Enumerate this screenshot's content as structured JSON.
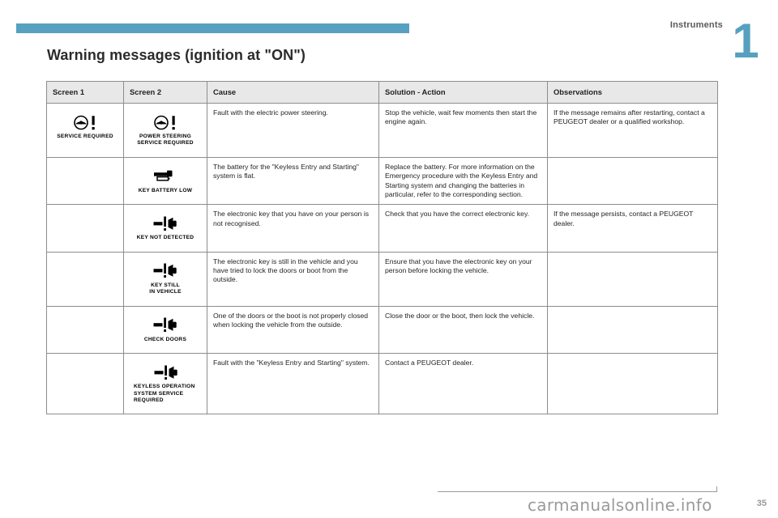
{
  "header": {
    "chapter_name": "Instruments",
    "chapter_number": "1"
  },
  "section_title": "Warning messages (ignition at \"ON\")",
  "table": {
    "columns": [
      "Screen 1",
      "Screen 2",
      "Cause",
      "Solution - Action",
      "Observations"
    ],
    "rows": [
      {
        "screen1": {
          "icon": "steering-wheel-warning-icon",
          "label": "SERVICE REQUIRED",
          "label_align": "center"
        },
        "screen2": {
          "icon": "steering-wheel-warning-icon",
          "label": "POWER STEERING\nSERVICE REQUIRED",
          "label_align": "center"
        },
        "cause": "Fault with the electric power steering.",
        "solution": "Stop the vehicle, wait few moments then start the engine again.",
        "observations": "If the message remains after restarting, contact a PEUGEOT dealer or a qualified workshop."
      },
      {
        "screen1": null,
        "screen2": {
          "icon": "key-battery-icon",
          "label": "KEY BATTERY LOW",
          "label_align": "center"
        },
        "cause": "The battery for the \"Keyless Entry and Starting\" system is flat.",
        "solution": "Replace the battery. For more information on the Emergency procedure with the Keyless Entry and Starting system and changing the batteries in particular, refer to the corresponding section.",
        "observations": ""
      },
      {
        "screen1": null,
        "screen2": {
          "icon": "key-not-detected-icon",
          "label": "KEY NOT DETECTED",
          "label_align": "center"
        },
        "cause": "The electronic key that you have on your person is not recognised.",
        "solution": "Check that you have the correct electronic key.",
        "observations": "If the message persists, contact a PEUGEOT dealer."
      },
      {
        "screen1": null,
        "screen2": {
          "icon": "key-not-detected-icon",
          "label": "KEY STILL\nIN VEHICLE",
          "label_align": "center"
        },
        "cause": "The electronic key is still in the vehicle and you have tried to lock the doors or boot from the outside.",
        "solution": "Ensure that you have the electronic key on your person before locking the vehicle.",
        "observations": ""
      },
      {
        "screen1": null,
        "screen2": {
          "icon": "key-not-detected-icon",
          "label": "CHECK DOORS",
          "label_align": "center"
        },
        "cause": "One of the doors or the boot is not properly closed when locking the vehicle from the outside.",
        "solution": "Close the door or the boot, then lock the vehicle.",
        "observations": ""
      },
      {
        "screen1": null,
        "screen2": {
          "icon": "key-not-detected-icon",
          "label": "KEYLESS OPERATION\nSYSTEM SERVICE\nREQUIRED",
          "label_align": "left"
        },
        "cause": "Fault with the \"Keyless Entry and Starting\" system.",
        "solution": "Contact a PEUGEOT dealer.",
        "observations": ""
      }
    ]
  },
  "footer": {
    "watermark": "carmanualsonline.info",
    "page_number": "35"
  },
  "colors": {
    "accent": "#57a0bf",
    "header_bg": "#e8e8e8",
    "border": "#8d8d8d",
    "text": "#231f20"
  }
}
